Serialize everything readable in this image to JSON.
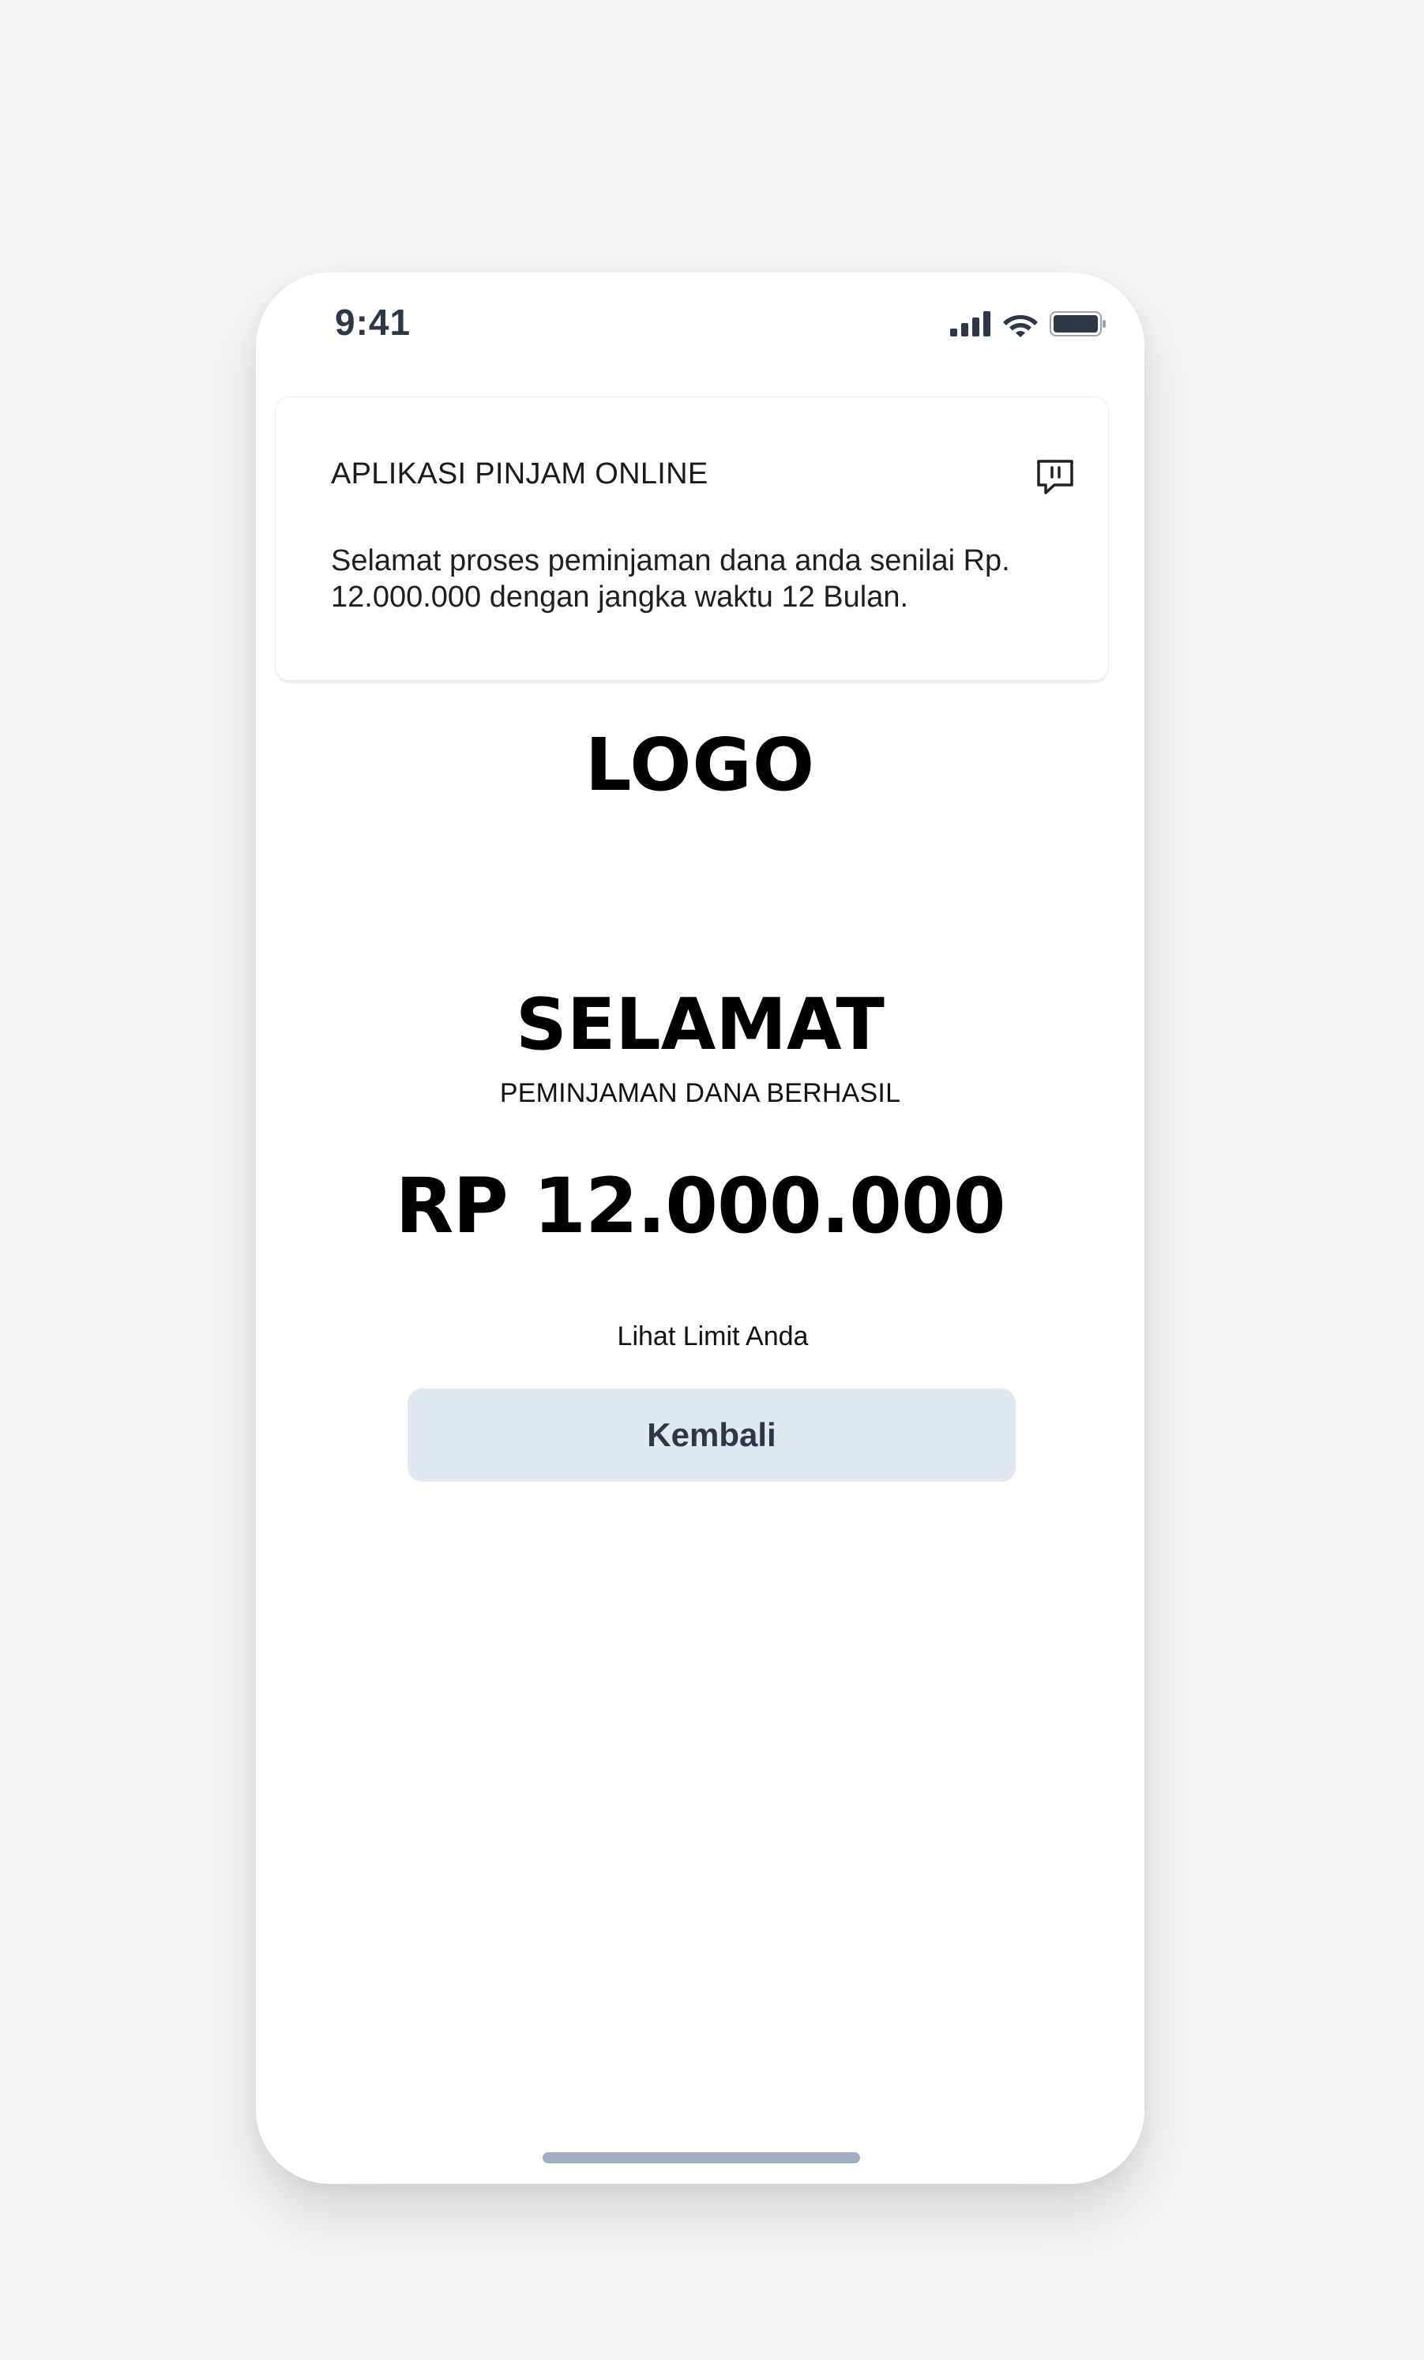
{
  "status_bar": {
    "time": "9:41",
    "icons": [
      "signal-icon",
      "wifi-icon",
      "battery-icon"
    ]
  },
  "notification": {
    "title": "APLIKASI PINJAM ONLINE",
    "body": "Selamat proses peminjaman dana anda senilai Rp. 12.000.000 dengan jangka waktu 12 Bulan.",
    "icon": "chat-pause-icon"
  },
  "logo_text": "LOGO",
  "main": {
    "title": "SELAMAT",
    "subtitle": "PEMINJAMAN DANA BERHASIL",
    "amount": "RP 12.000.000",
    "limit_link": "Lihat Limit Anda",
    "back_button": "Kembali"
  },
  "colors": {
    "page_background": "#f5f5f5",
    "button_background": "#e2e8f0",
    "button_text": "#2d3748",
    "home_indicator": "#a0aec0"
  }
}
